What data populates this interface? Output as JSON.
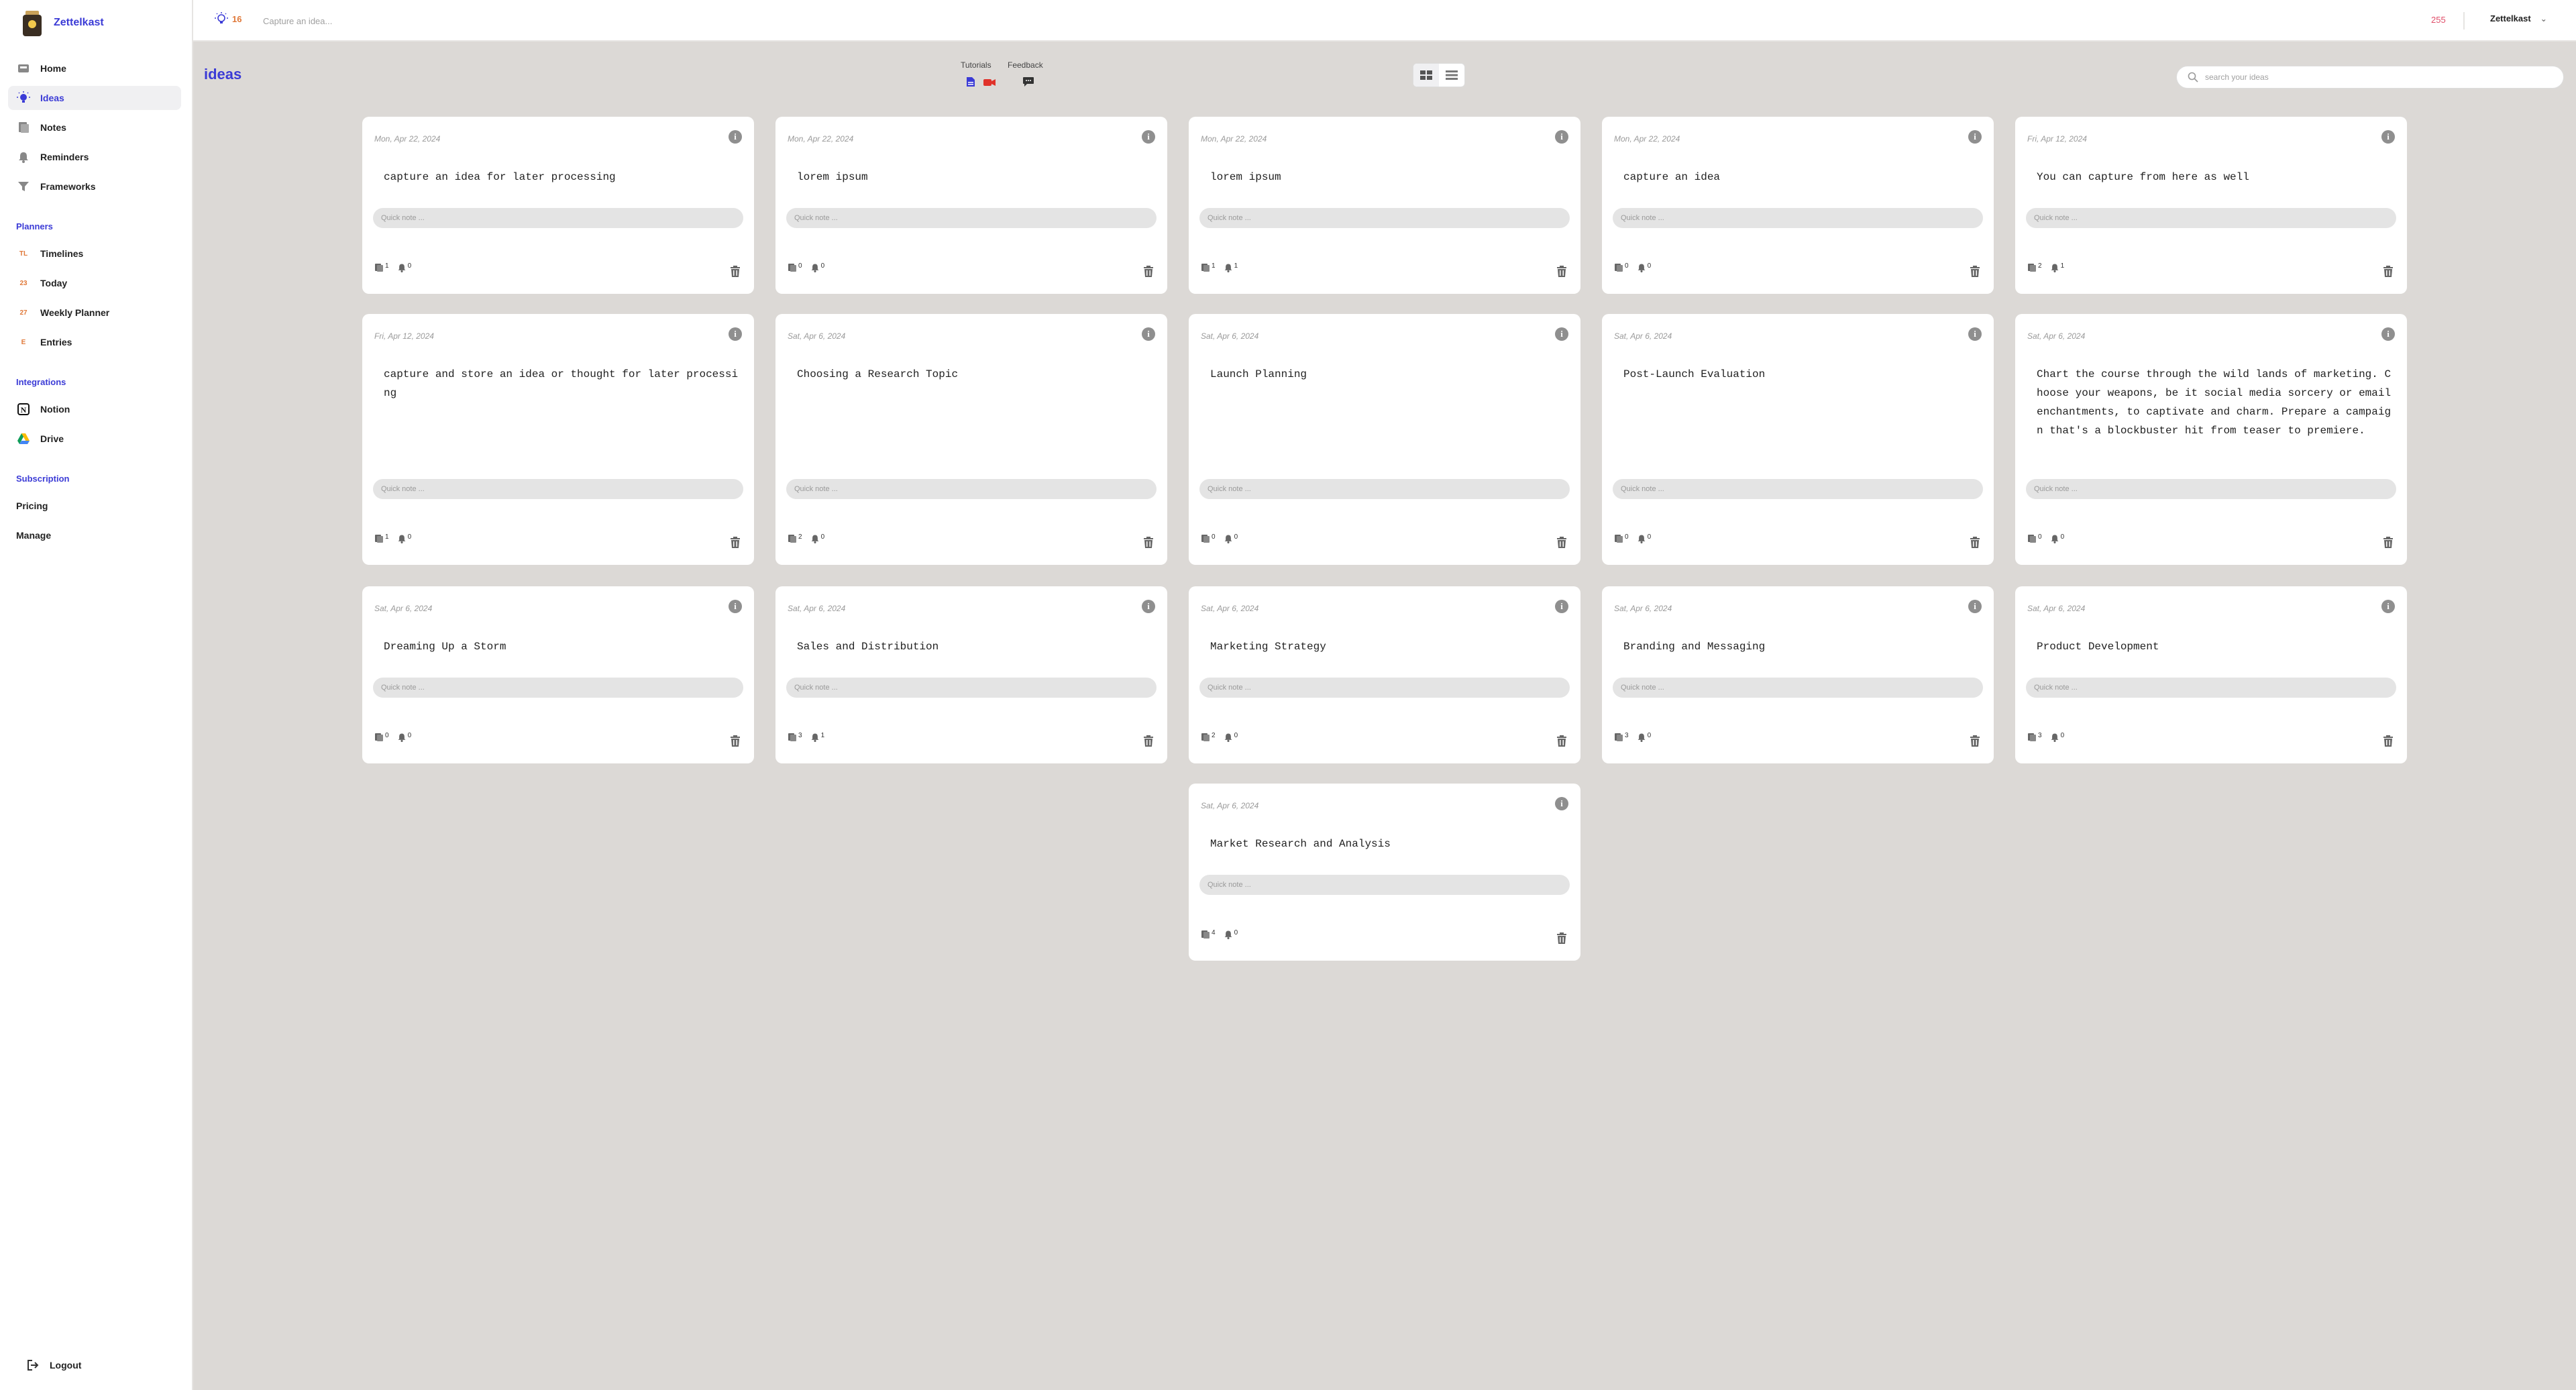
{
  "brand": {
    "name": "Zettelkast"
  },
  "nav": {
    "main": [
      {
        "label": "Home",
        "icon": "home-icon"
      },
      {
        "label": "Ideas",
        "icon": "lightbulb-icon",
        "active": true
      },
      {
        "label": "Notes",
        "icon": "notes-icon"
      },
      {
        "label": "Reminders",
        "icon": "bell-icon"
      },
      {
        "label": "Frameworks",
        "icon": "filter-icon"
      }
    ],
    "planners_title": "Planners",
    "planners": [
      {
        "label": "Timelines",
        "badge": "TL"
      },
      {
        "label": "Today",
        "badge": "23"
      },
      {
        "label": "Weekly Planner",
        "badge": "27"
      },
      {
        "label": "Entries",
        "badge": "E"
      }
    ],
    "integrations_title": "Integrations",
    "integrations": [
      {
        "label": "Notion",
        "icon": "notion-icon"
      },
      {
        "label": "Drive",
        "icon": "drive-icon"
      }
    ],
    "subscription_title": "Subscription",
    "subscription": [
      {
        "label": "Pricing"
      },
      {
        "label": "Manage"
      }
    ],
    "logout_label": "Logout"
  },
  "topbar": {
    "idea_count": "16",
    "capture_placeholder": "Capture an idea...",
    "counter": "255",
    "account_name": "Zettelkast"
  },
  "page": {
    "title": "ideas",
    "tutorials_label": "Tutorials",
    "feedback_label": "Feedback",
    "search_placeholder": "search your ideas"
  },
  "note_placeholder": "Quick note ...",
  "cards": [
    {
      "date": "Mon, Apr 22, 2024",
      "text": "capture an idea for later processing",
      "notes": "1",
      "reminders": "0"
    },
    {
      "date": "Mon, Apr 22, 2024",
      "text": "lorem ipsum",
      "notes": "0",
      "reminders": "0"
    },
    {
      "date": "Mon, Apr 22, 2024",
      "text": "lorem ipsum",
      "notes": "1",
      "reminders": "1"
    },
    {
      "date": "Mon, Apr 22, 2024",
      "text": "capture an idea",
      "notes": "0",
      "reminders": "0"
    },
    {
      "date": "Fri, Apr 12, 2024",
      "text": "You can capture from here as well",
      "notes": "2",
      "reminders": "1"
    },
    {
      "date": "Fri, Apr 12, 2024",
      "text": "capture and store an idea or thought for later processing",
      "notes": "1",
      "reminders": "0"
    },
    {
      "date": "Sat, Apr 6, 2024",
      "text": "Choosing a Research Topic",
      "notes": "2",
      "reminders": "0"
    },
    {
      "date": "Sat, Apr 6, 2024",
      "text": "Launch Planning",
      "notes": "0",
      "reminders": "0"
    },
    {
      "date": "Sat, Apr 6, 2024",
      "text": "Post-Launch Evaluation",
      "notes": "0",
      "reminders": "0"
    },
    {
      "date": "Sat, Apr 6, 2024",
      "text": "Chart the course through the wild lands of marketing. Choose your weapons, be it social media sorcery or email enchantments, to captivate and charm. Prepare a campaign that's a blockbuster hit from teaser to premiere.",
      "notes": "0",
      "reminders": "0"
    },
    {
      "date": "Sat, Apr 6, 2024",
      "text": "Dreaming Up a Storm",
      "notes": "0",
      "reminders": "0"
    },
    {
      "date": "Sat, Apr 6, 2024",
      "text": "Sales and Distribution",
      "notes": "3",
      "reminders": "1"
    },
    {
      "date": "Sat, Apr 6, 2024",
      "text": "Marketing Strategy",
      "notes": "2",
      "reminders": "0"
    },
    {
      "date": "Sat, Apr 6, 2024",
      "text": "Branding and Messaging",
      "notes": "3",
      "reminders": "0"
    },
    {
      "date": "Sat, Apr 6, 2024",
      "text": "Product Development",
      "notes": "3",
      "reminders": "0"
    },
    {
      "date": "Sat, Apr 6, 2024",
      "text": "Market Research and Analysis",
      "notes": "4",
      "reminders": "0"
    }
  ]
}
